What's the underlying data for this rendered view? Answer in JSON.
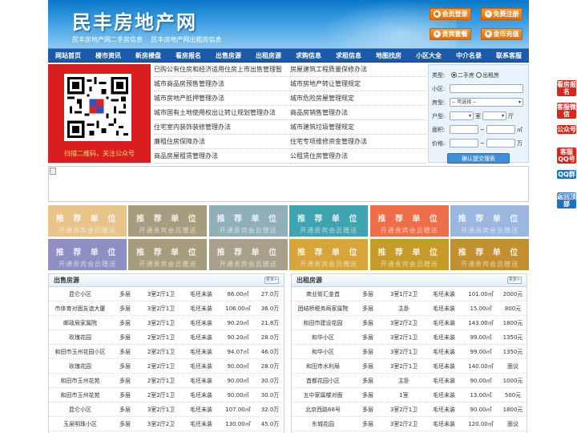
{
  "header": {
    "title": "民丰房地产网",
    "subtitle1": "民丰房地产网二手房信息",
    "subtitle2": "民丰房地产网出租房信息",
    "buttons": [
      "会员登录",
      "免费注册",
      "贵宾套餐",
      "金币充值"
    ]
  },
  "nav": [
    "网站首页",
    "楼市资讯",
    "新房楼盘",
    "看房报名",
    "出售房源",
    "出租房源",
    "求购信息",
    "求租信息",
    "地图找房",
    "小区大全",
    "中介名录",
    "联系客服"
  ],
  "qr": {
    "caption": "扫描二维码，关注公众号"
  },
  "news_left": [
    "已购公有住房和经济适用住房上市出售管理暂",
    "城市商品房预售管理办法",
    "城市房地产抵押管理办法",
    "城市国有土地使用权出让转让规划管理办法",
    "住宅室内装饰装修管理办法",
    "廉租住房保障办法",
    "商品房屋租赁管理办法"
  ],
  "news_right": [
    "房屋建筑工程质量保修办法",
    "城市房地产转让管理规定",
    "城市危险房屋管理规定",
    "商品房销售管理办法",
    "城市建筑垃圾管理规定",
    "住宅专项维修资金管理办法",
    "公租赁住房管理办法"
  ],
  "search": {
    "type_label": "类型:",
    "opt1": "二手房",
    "opt2": "出租房",
    "xiaoqu_label": "小区:",
    "fangxing_label": "房型:",
    "fangxing_value": "-- 可选择 --",
    "huxing_label": "户型:",
    "shi": "室",
    "ting": "厅",
    "area_label": "面积:",
    "area_unit": "㎡",
    "price_label": "价格:",
    "price_unit": "万",
    "tilde": "~",
    "submit": "确认提交搜索"
  },
  "ads": {
    "line1": "推 荐 单 位",
    "line2": "开通贵宾会员赠送"
  },
  "colors": {
    "ad_tiles": [
      "#e8c48a",
      "#a89c7e",
      "#8fb0b8",
      "#3fa4b0",
      "#ee6e4a",
      "#9bb7e0",
      "#8f8fc4",
      "#a89c7e",
      "#a8a08a",
      "#d8a43c",
      "#c79b28",
      "#c29030"
    ],
    "side_buttons": [
      "#d9261c",
      "#d9261c",
      "#d9261c",
      "#d9261c",
      "#1f6fc4",
      "#1f6fc4"
    ]
  },
  "sale": {
    "title": "出售房源",
    "more": "更多>",
    "rows": [
      [
        "昆仑小区",
        "多层",
        "3室2厅1卫",
        "毛坯未装",
        "86.00㎡",
        "27.0万"
      ],
      [
        "市体育对面友谊大厦",
        "多层",
        "3室2厅1卫",
        "毛坯未装",
        "106.00㎡",
        "36.0万"
      ],
      [
        "邮政局家属院",
        "多层",
        "3室2厅1卫",
        "毛坯未装",
        "90.20㎡",
        "21.8万"
      ],
      [
        "玫瑰花园",
        "多层",
        "2室2厅1卫",
        "毛坯未装",
        "90.20㎡",
        "28.0万"
      ],
      [
        "和田市玉州花园小区",
        "多层",
        "2室2厅1卫",
        "毛坯未装",
        "94.07㎡",
        "46.0万"
      ],
      [
        "玫瑰花园",
        "多层",
        "2室2厅1卫",
        "毛坯未装",
        "90.00㎡",
        "28.0万"
      ],
      [
        "和田市玉州花苑",
        "多层",
        "2室2厅1卫",
        "毛坯未装",
        "90.00㎡",
        "30.0万"
      ],
      [
        "和田市玉州花苑",
        "多层",
        "2室2厅1卫",
        "毛坯未装",
        "90.00㎡",
        "30.0万"
      ],
      [
        "昆仑小区",
        "多层",
        "3室2厅1卫",
        "毛坯未装",
        "107.00㎡",
        "32.0万"
      ],
      [
        "玉泉明珠小区",
        "多层",
        "3室2厅2卫",
        "毛坯未装",
        "130.00㎡",
        "45.0万"
      ]
    ]
  },
  "rent": {
    "title": "出租房源",
    "more": "更多>",
    "rows": [
      [
        "商业街汇金首",
        "多层",
        "3室1厅2卫",
        "毛坯未装",
        "101.00㎡",
        "2000元"
      ],
      [
        "团结桥税务局家属院",
        "多层",
        "主卧",
        "毛坯未装",
        "15.00㎡",
        "800元"
      ],
      [
        "和田市建设花园",
        "多层",
        "3室2厅2卫",
        "毛坯未装",
        "143.00㎡",
        "1800元"
      ],
      [
        "和华小区",
        "多层",
        "3室2厅1卫",
        "毛坯未装",
        "99.00㎡",
        "1350元"
      ],
      [
        "和华小区",
        "多层",
        "3室2厅1卫",
        "毛坯未装",
        "99.00㎡",
        "1350元"
      ],
      [
        "和田市水利局",
        "多层",
        "3室2厅1卫",
        "毛坯未装",
        "140.00㎡",
        "面议"
      ],
      [
        "首都花园小区",
        "多层",
        "主卧",
        "毛坯未装",
        "90.00㎡",
        "1000元"
      ],
      [
        "五中家属楼对面",
        "多层",
        "1室",
        "毛坯未装",
        "13.00㎡",
        "500元"
      ],
      [
        "北京西路68号",
        "多层",
        "3室2厅1卫",
        "毛坯未装",
        "90.00㎡",
        "1800元"
      ],
      [
        "东城花园",
        "多层",
        "3室2厅2卫",
        "毛坯未装",
        "120.00㎡",
        "面议"
      ]
    ]
  },
  "side": [
    "看房报名",
    "客服微信",
    "公众号",
    "客服QQ号",
    "QQ群",
    "返回顶部"
  ]
}
